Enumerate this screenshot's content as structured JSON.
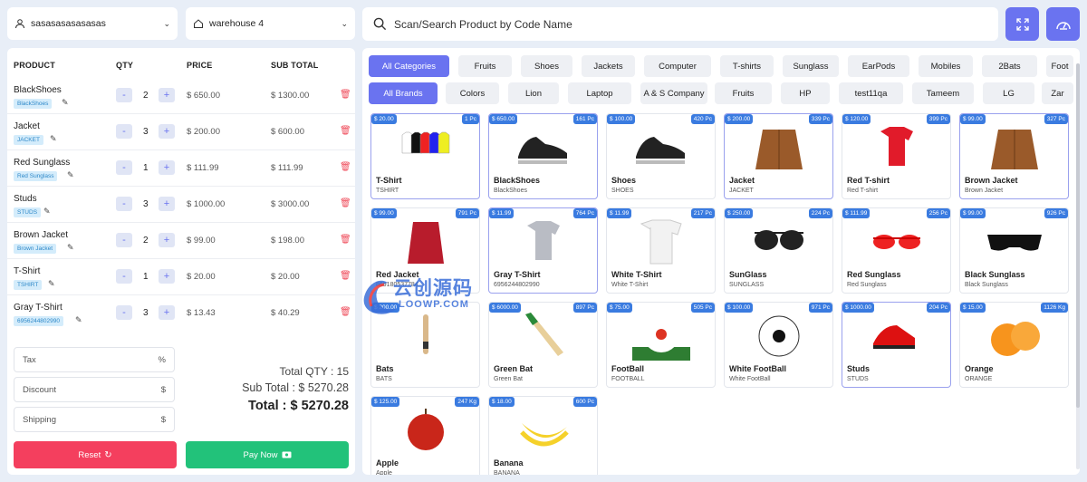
{
  "top": {
    "customer": "sasasasasasasas",
    "warehouse": "warehouse 4",
    "search_placeholder": "Scan/Search Product by Code Name"
  },
  "cart": {
    "headers": [
      "PRODUCT",
      "QTY",
      "PRICE",
      "SUB TOTAL"
    ],
    "items": [
      {
        "name": "BlackShoes",
        "code": "BlackShoes",
        "qty": "2",
        "price": "$ 650.00",
        "subtotal": "$ 1300.00"
      },
      {
        "name": "Jacket",
        "code": "JACKET",
        "qty": "3",
        "price": "$ 200.00",
        "subtotal": "$ 600.00"
      },
      {
        "name": "Red Sunglass",
        "code": "Red Sunglass",
        "qty": "1",
        "price": "$ 111.99",
        "subtotal": "$ 111.99"
      },
      {
        "name": "Studs",
        "code": "STUDS",
        "qty": "3",
        "price": "$ 1000.00",
        "subtotal": "$ 3000.00"
      },
      {
        "name": "Brown Jacket",
        "code": "Brown Jacket",
        "qty": "2",
        "price": "$ 99.00",
        "subtotal": "$ 198.00"
      },
      {
        "name": "T-Shirt",
        "code": "TSHIRT",
        "qty": "1",
        "price": "$ 20.00",
        "subtotal": "$ 20.00"
      },
      {
        "name": "Gray T-Shirt",
        "code": "6956244802990",
        "qty": "3",
        "price": "$ 13.43",
        "subtotal": "$ 40.29"
      }
    ],
    "inputs": {
      "tax": {
        "placeholder": "Tax",
        "unit": "%"
      },
      "discount": {
        "placeholder": "Discount",
        "unit": "$"
      },
      "shipping": {
        "placeholder": "Shipping",
        "unit": "$"
      }
    },
    "totals": {
      "qty": "Total QTY : 15",
      "subtotal": "Sub Total : $ 5270.28",
      "total": "Total : $ 5270.28"
    },
    "reset_label": "Reset",
    "pay_label": "Pay Now"
  },
  "categories": [
    "All Categories",
    "Fruits",
    "Shoes",
    "Jackets",
    "Computer",
    "T-shirts",
    "Sunglass",
    "EarPods",
    "Mobiles",
    "2Bats",
    "Foot"
  ],
  "brands": [
    "All Brands",
    "Colors",
    "Lion",
    "Laptop",
    "A & S Company",
    "Fruits",
    "HP",
    "test11qa",
    "Tameem",
    "LG",
    "Zar"
  ],
  "products": [
    {
      "name": "T-Shirt",
      "code": "TSHIRT",
      "price": "$ 20.00",
      "stock": "1 Pc"
    },
    {
      "name": "BlackShoes",
      "code": "BlackShoes",
      "price": "$ 650.00",
      "stock": "161 Pc"
    },
    {
      "name": "Shoes",
      "code": "SHOES",
      "price": "$ 100.00",
      "stock": "420 Pc"
    },
    {
      "name": "Jacket",
      "code": "JACKET",
      "price": "$ 200.00",
      "stock": "339 Pc"
    },
    {
      "name": "Red T-shirt",
      "code": "Red T-shirt",
      "price": "$ 120.00",
      "stock": "399 Pc"
    },
    {
      "name": "Brown Jacket",
      "code": "Brown Jacket",
      "price": "$ 99.00",
      "stock": "327 Pc"
    },
    {
      "name": "Red Jacket",
      "code": "869180537784",
      "price": "$ 99.00",
      "stock": "791 Pc"
    },
    {
      "name": "Gray T-Shirt",
      "code": "6956244802990",
      "price": "$ 11.99",
      "stock": "764 Pc"
    },
    {
      "name": "White T-Shirt",
      "code": "White T-Shirt",
      "price": "$ 11.99",
      "stock": "217 Pc"
    },
    {
      "name": "SunGlass",
      "code": "SUNGLASS",
      "price": "$ 250.00",
      "stock": "224 Pc"
    },
    {
      "name": "Red Sunglass",
      "code": "Red Sunglass",
      "price": "$ 111.99",
      "stock": "256 Pc"
    },
    {
      "name": "Black Sunglass",
      "code": "Black Sunglass",
      "price": "$ 99.00",
      "stock": "926 Pc"
    },
    {
      "name": "Bats",
      "code": "BATS",
      "price": "$ 200.00",
      "stock": ""
    },
    {
      "name": "Green Bat",
      "code": "Green Bat",
      "price": "$ 6000.00",
      "stock": "897 Pc"
    },
    {
      "name": "FootBall",
      "code": "FOOTBALL",
      "price": "$ 75.00",
      "stock": "505 Pc"
    },
    {
      "name": "White FootBall",
      "code": "White FootBall",
      "price": "$ 100.00",
      "stock": "971 Pc"
    },
    {
      "name": "Studs",
      "code": "STUDS",
      "price": "$ 1000.00",
      "stock": "204 Pc"
    },
    {
      "name": "Orange",
      "code": "ORANGE",
      "price": "$ 15.00",
      "stock": "1126 Kg"
    },
    {
      "name": "Apple",
      "code": "Apple",
      "price": "$ 125.00",
      "stock": "247 Kg"
    },
    {
      "name": "Banana",
      "code": "BANANA",
      "price": "$ 18.00",
      "stock": "600 Pc"
    }
  ],
  "watermark": {
    "line1": "云创源码",
    "line2": "LOOWP.COM"
  },
  "colors": {
    "accent": "#6a73f0",
    "danger": "#f43f5e",
    "success": "#22c27a",
    "tag": "#3a7be0"
  }
}
